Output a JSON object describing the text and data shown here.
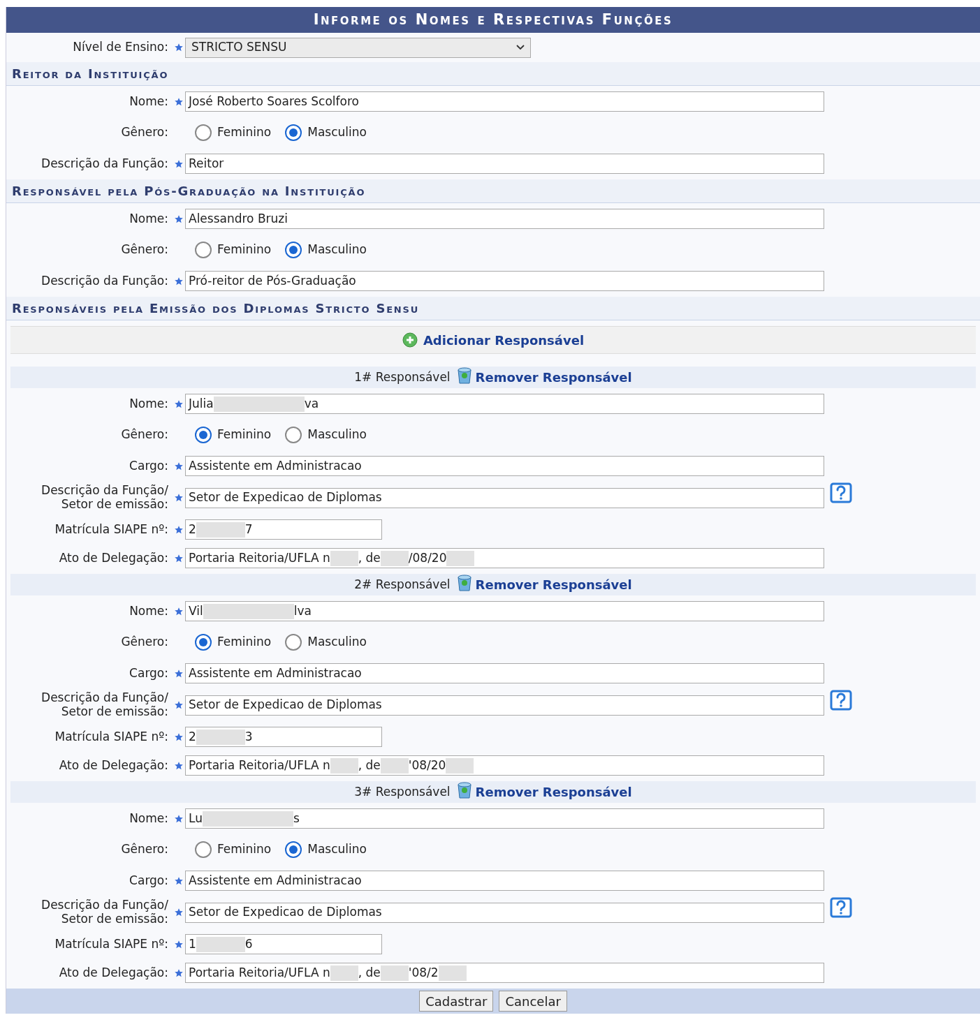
{
  "title": "Informe os Nomes e Respectivas Funções",
  "nivel": {
    "label": "Nível de Ensino:",
    "required": true,
    "value": "STRICTO SENSU"
  },
  "sections": [
    {
      "title": "Reitor da Instituição",
      "fields": [
        {
          "kind": "text",
          "label": "Nome:",
          "required": true,
          "value": [
            "José Roberto Soares Scolforo"
          ]
        },
        {
          "kind": "radio",
          "label": "Gênero:",
          "required": false,
          "options": [
            {
              "label": "Feminino",
              "selected": false
            },
            {
              "label": "Masculino",
              "selected": true
            }
          ]
        },
        {
          "kind": "text",
          "label": "Descrição da Função:",
          "required": true,
          "value": [
            "Reitor"
          ]
        }
      ]
    },
    {
      "title": "Responsável pela Pós-Graduação na Instituição",
      "fields": [
        {
          "kind": "text",
          "label": "Nome:",
          "required": true,
          "value": [
            "Alessandro Bruzi"
          ]
        },
        {
          "kind": "radio",
          "label": "Gênero:",
          "required": false,
          "options": [
            {
              "label": "Feminino",
              "selected": false
            },
            {
              "label": "Masculino",
              "selected": true
            }
          ]
        },
        {
          "kind": "text",
          "label": "Descrição da Função:",
          "required": true,
          "value": [
            "Pró-reitor de Pós-Graduação"
          ]
        }
      ]
    }
  ],
  "diplomas": {
    "title": "Responsáveis pela Emissão dos Diplomas Stricto Sensu",
    "add_link": "Adicionar Responsável",
    "responsaveis": [
      {
        "heading": "1# Responsável",
        "remove_link": "Remover Responsável",
        "fields": [
          {
            "kind": "text",
            "label": "Nome:",
            "required": true,
            "value": [
              "Julia",
              "va"
            ]
          },
          {
            "kind": "radio",
            "label": "Gênero:",
            "required": false,
            "options": [
              {
                "label": "Feminino",
                "selected": true
              },
              {
                "label": "Masculino",
                "selected": false
              }
            ]
          },
          {
            "kind": "text",
            "label": "Cargo:",
            "required": true,
            "value": [
              "Assistente em Administracao"
            ]
          },
          {
            "kind": "help",
            "label_lines": [
              "Descrição da Função/",
              "Setor de emissão:"
            ],
            "required": true,
            "value": [
              "Setor de Expedicao de Diplomas"
            ]
          },
          {
            "kind": "short",
            "label": "Matrícula SIAPE nº:",
            "required": true,
            "value": [
              "2",
              "7"
            ]
          },
          {
            "kind": "text",
            "label": "Ato de Delegação:",
            "required": true,
            "value": [
              "Portaria Reitoria/UFLA n",
              ", de",
              "/08/20"
            ],
            "redacted_end": true
          }
        ]
      },
      {
        "heading": "2# Responsável",
        "remove_link": "Remover Responsável",
        "fields": [
          {
            "kind": "text",
            "label": "Nome:",
            "required": true,
            "value": [
              "Vil",
              "lva"
            ]
          },
          {
            "kind": "radio",
            "label": "Gênero:",
            "required": false,
            "options": [
              {
                "label": "Feminino",
                "selected": true
              },
              {
                "label": "Masculino",
                "selected": false
              }
            ]
          },
          {
            "kind": "text",
            "label": "Cargo:",
            "required": true,
            "value": [
              "Assistente em Administracao"
            ]
          },
          {
            "kind": "help",
            "label_lines": [
              "Descrição da Função/",
              "Setor de emissão:"
            ],
            "required": true,
            "value": [
              "Setor de Expedicao de Diplomas"
            ]
          },
          {
            "kind": "short",
            "label": "Matrícula SIAPE nº:",
            "required": true,
            "value": [
              "2",
              "3"
            ]
          },
          {
            "kind": "text",
            "label": "Ato de Delegação:",
            "required": true,
            "value": [
              "Portaria Reitoria/UFLA n",
              ", de",
              "'08/20"
            ],
            "redacted_end": true
          }
        ]
      },
      {
        "heading": "3# Responsável",
        "remove_link": "Remover Responsável",
        "fields": [
          {
            "kind": "text",
            "label": "Nome:",
            "required": true,
            "value": [
              "Lu",
              "s"
            ]
          },
          {
            "kind": "radio",
            "label": "Gênero:",
            "required": false,
            "options": [
              {
                "label": "Feminino",
                "selected": false
              },
              {
                "label": "Masculino",
                "selected": true
              }
            ]
          },
          {
            "kind": "text",
            "label": "Cargo:",
            "required": true,
            "value": [
              "Assistente em Administracao"
            ]
          },
          {
            "kind": "help",
            "label_lines": [
              "Descrição da Função/",
              "Setor de emissão:"
            ],
            "required": true,
            "value": [
              "Setor de Expedicao de Diplomas"
            ]
          },
          {
            "kind": "short",
            "label": "Matrícula SIAPE nº:",
            "required": true,
            "value": [
              "1",
              "6"
            ]
          },
          {
            "kind": "text",
            "label": "Ato de Delegação:",
            "required": true,
            "value": [
              "Portaria Reitoria/UFLA n",
              ", de",
              "'08/2"
            ],
            "redacted_end": true
          }
        ]
      }
    ]
  },
  "buttons": [
    "Cadastrar",
    "Cancelar"
  ]
}
